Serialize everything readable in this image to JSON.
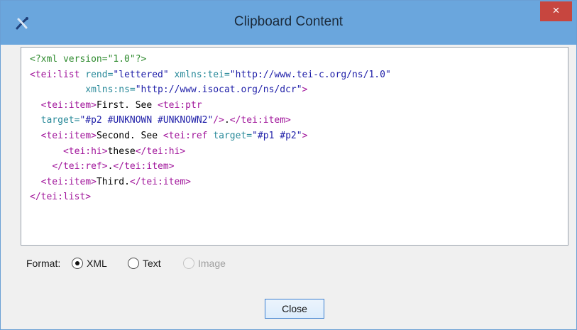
{
  "window": {
    "title": "Clipboard Content",
    "app_icon": "app-logo-icon",
    "close_glyph": "×"
  },
  "editor": {
    "lines": [
      [
        {
          "c": "pi",
          "t": "<?xml version=\"1.0\"?>"
        }
      ],
      [
        {
          "c": "tag",
          "t": "<tei:list "
        },
        {
          "c": "attr",
          "t": "rend="
        },
        {
          "c": "val",
          "t": "\"lettered\" "
        },
        {
          "c": "attr",
          "t": "xmlns:tei="
        },
        {
          "c": "val",
          "t": "\"http://www.tei-c.org/ns/1.0\""
        }
      ],
      [
        {
          "c": "txt",
          "t": "          "
        },
        {
          "c": "attr",
          "t": "xmlns:ns="
        },
        {
          "c": "val",
          "t": "\"http://www.isocat.org/ns/dcr\""
        },
        {
          "c": "tag",
          "t": ">"
        }
      ],
      [
        {
          "c": "txt",
          "t": "  "
        },
        {
          "c": "tag",
          "t": "<tei:item>"
        },
        {
          "c": "txt",
          "t": "First. See "
        },
        {
          "c": "tag",
          "t": "<tei:ptr"
        }
      ],
      [
        {
          "c": "txt",
          "t": "  "
        },
        {
          "c": "attr",
          "t": "target="
        },
        {
          "c": "val",
          "t": "\"#p2 #UNKNOWN #UNKNOWN2\""
        },
        {
          "c": "tag",
          "t": "/>"
        },
        {
          "c": "txt",
          "t": "."
        },
        {
          "c": "tag",
          "t": "</tei:item>"
        }
      ],
      [
        {
          "c": "txt",
          "t": "  "
        },
        {
          "c": "tag",
          "t": "<tei:item>"
        },
        {
          "c": "txt",
          "t": "Second. See "
        },
        {
          "c": "tag",
          "t": "<tei:ref "
        },
        {
          "c": "attr",
          "t": "target="
        },
        {
          "c": "val",
          "t": "\"#p1 #p2\""
        },
        {
          "c": "tag",
          "t": ">"
        }
      ],
      [
        {
          "c": "txt",
          "t": "      "
        },
        {
          "c": "tag",
          "t": "<tei:hi>"
        },
        {
          "c": "txt",
          "t": "these"
        },
        {
          "c": "tag",
          "t": "</tei:hi>"
        }
      ],
      [
        {
          "c": "txt",
          "t": "    "
        },
        {
          "c": "tag",
          "t": "</tei:ref>"
        },
        {
          "c": "txt",
          "t": "."
        },
        {
          "c": "tag",
          "t": "</tei:item>"
        }
      ],
      [
        {
          "c": "txt",
          "t": "  "
        },
        {
          "c": "tag",
          "t": "<tei:item>"
        },
        {
          "c": "txt",
          "t": "Third."
        },
        {
          "c": "tag",
          "t": "</tei:item>"
        }
      ],
      [
        {
          "c": "tag",
          "t": "</tei:list>"
        }
      ]
    ]
  },
  "format": {
    "label": "Format:",
    "options": [
      {
        "label": "XML",
        "selected": true,
        "enabled": true
      },
      {
        "label": "Text",
        "selected": false,
        "enabled": true
      },
      {
        "label": "Image",
        "selected": false,
        "enabled": false
      }
    ]
  },
  "buttons": {
    "close_label": "Close"
  }
}
